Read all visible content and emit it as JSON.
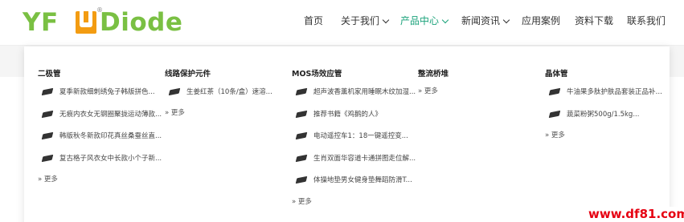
{
  "logo": {
    "brand_left": "YF",
    "brand_reg": "®",
    "brand_right": "Diode"
  },
  "nav": [
    {
      "label": "首页",
      "dropdown": false,
      "active": false
    },
    {
      "label": "关于我们",
      "dropdown": true,
      "active": false
    },
    {
      "label": "产品中心",
      "dropdown": true,
      "active": true
    },
    {
      "label": "新闻资讯",
      "dropdown": true,
      "active": false
    },
    {
      "label": "应用案例",
      "dropdown": false,
      "active": false
    },
    {
      "label": "资料下载",
      "dropdown": false,
      "active": false
    },
    {
      "label": "联系我们",
      "dropdown": false,
      "active": false
    }
  ],
  "dropdown": {
    "columns": [
      {
        "title": "二极管",
        "items": [
          "夏季新款细刺绣兔子韩版拼色...",
          "无痕内衣女无钢圈聚拢运动薄款...",
          "韩版秋冬新款印花真丝桑蚕丝直...",
          "复古格子风衣女中长款小个子新..."
        ],
        "more": "» 更多"
      },
      {
        "title": "线路保护元件",
        "items": [
          "生姜红茶（10条/盒）速溶..."
        ],
        "more": "» 更多"
      },
      {
        "title": "MOS场效应管",
        "items": [
          "超声波香薰机家用睡眠木纹加湿...",
          "推荐书籍《鸡鹅的人》",
          "电动遥控车1：18一键遥控变...",
          "生肖双面华容道卡通拼图走位解...",
          "体操地垫男女健身垫舞蹈防滑T..."
        ],
        "more": "» 更多"
      },
      {
        "title": "整流桥堆",
        "items": [],
        "more": "» 更多"
      },
      {
        "title": "晶体管",
        "items": [
          "牛油果多肽护肤品套装正品补水...",
          "蔬菜粉粥500g/1.5kg..."
        ],
        "more": "» 更多"
      }
    ]
  },
  "watermark": "www.df81.com",
  "colors": {
    "brand_green": "#7ac043",
    "brand_orange": "#f39c12",
    "nav_active": "#1aa27a",
    "watermark_red": "#e60012"
  }
}
